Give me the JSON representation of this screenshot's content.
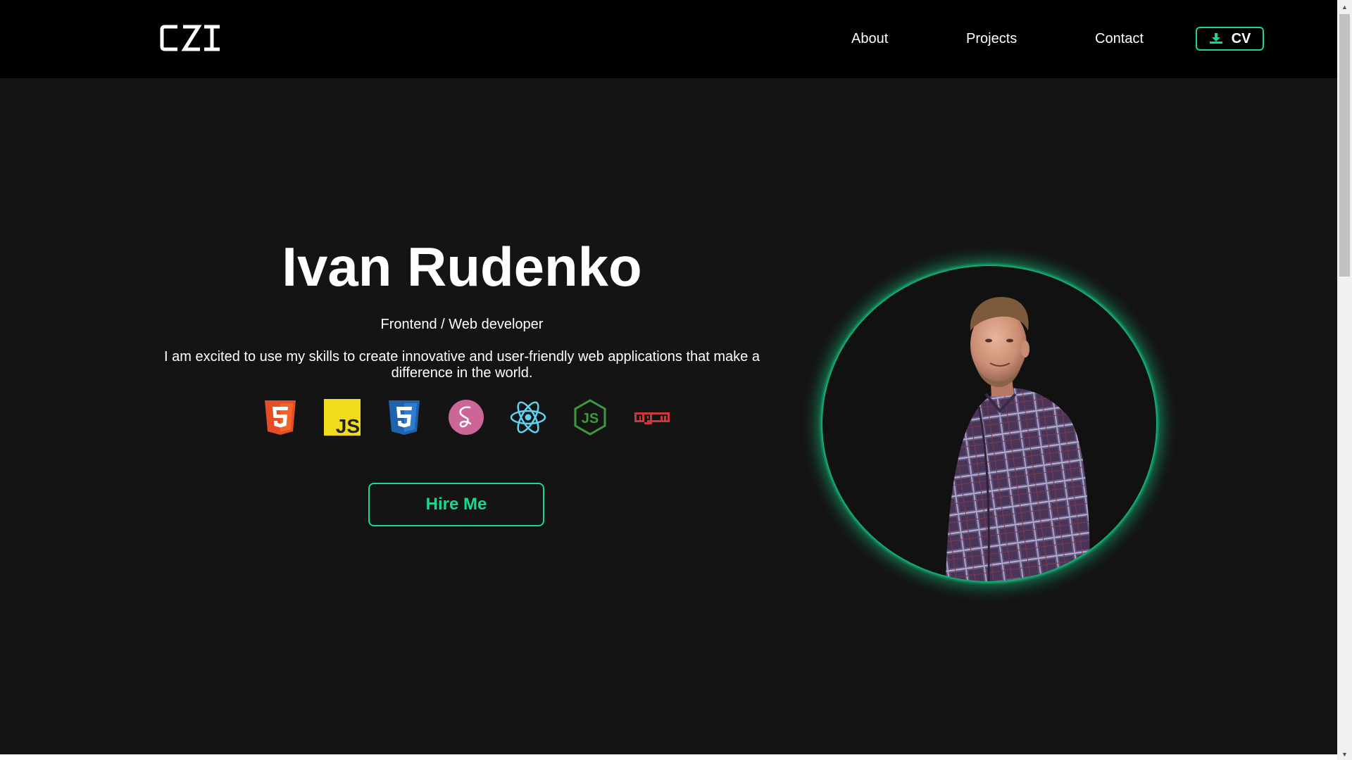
{
  "nav": {
    "logo_text": "CZI",
    "links": [
      {
        "label": "About"
      },
      {
        "label": "Projects"
      },
      {
        "label": "Contact"
      }
    ],
    "cv_label": "CV"
  },
  "hero": {
    "name": "Ivan Rudenko",
    "role": "Frontend / Web developer",
    "bio": "I am excited to use my skills to create innovative and user-friendly web applications that make a difference in the world.",
    "hire_label": "Hire Me",
    "tech_icons": [
      "html5-icon",
      "javascript-icon",
      "css3-icon",
      "sass-icon",
      "react-icon",
      "nodejs-icon",
      "npm-icon"
    ],
    "photo": "portrait-photo"
  },
  "colors": {
    "accent": "#16d98e",
    "navbar_bg": "#000000",
    "page_bg": "#141414",
    "text": "#ffffff"
  }
}
